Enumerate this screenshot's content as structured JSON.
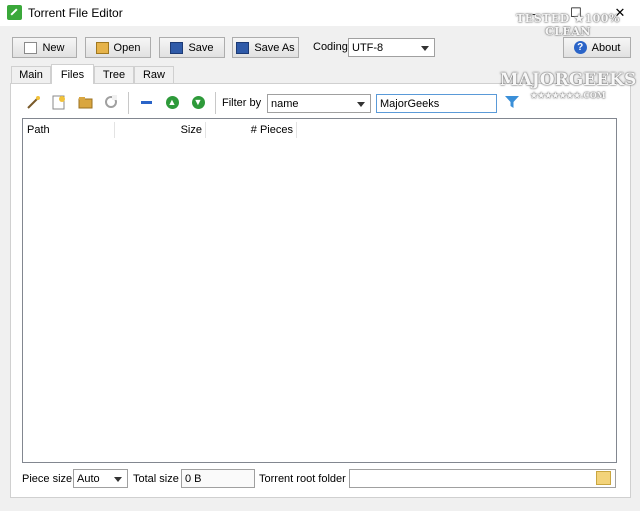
{
  "window": {
    "title": "Torrent File Editor",
    "minimize": "–",
    "maximize": "☐",
    "close": "✕"
  },
  "toolbar": {
    "new_label": "New",
    "open_label": "Open",
    "save_label": "Save",
    "save_as_label": "Save As",
    "coding_label": "Coding",
    "coding_value": "UTF-8",
    "about_label": "About"
  },
  "tabs": [
    {
      "label": "Main"
    },
    {
      "label": "Files"
    },
    {
      "label": "Tree"
    },
    {
      "label": "Raw"
    }
  ],
  "files_toolbar": {
    "filter_label": "Filter by",
    "filter_field": "name",
    "filter_text": "MajorGeeks"
  },
  "table": {
    "columns": [
      "Path",
      "Size",
      "# Pieces"
    ]
  },
  "footer": {
    "piece_size_label": "Piece size",
    "piece_size_value": "Auto",
    "total_size_label": "Total size",
    "total_size_value": "0 B",
    "root_folder_label": "Torrent root folder",
    "root_folder_value": ""
  },
  "watermark": {
    "line1": "TESTED ★100% CLEAN",
    "line2": "MAJORGEEKS",
    "line3": "★★★★★★★.COM"
  },
  "colors": {
    "accent_green": "#2e9a3a",
    "filter_blue": "#3a8fd8"
  }
}
